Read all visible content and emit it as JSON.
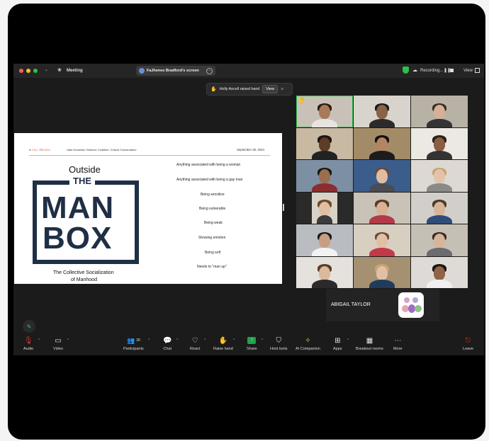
{
  "meeting": {
    "title": "Meeting",
    "share_label": "FaJhenee Bradford's screen",
    "recording_label": "Recording...",
    "view_label": "View"
  },
  "notification": {
    "text": "Holly Ancell raised hand",
    "view_button": "View",
    "close": "×"
  },
  "slide": {
    "brand_a": "A",
    "brand_call": "CALL",
    "brand_to": "TO",
    "brand_men": "MEN",
    "org": "Utah Domestic Violence Coalition: Critical Conversation",
    "date": "September 30, 2024",
    "outside": "Outside",
    "the": "THE",
    "man": "MAN",
    "box": "BOX",
    "caption_line1": "The Collective Socialization",
    "caption_line2": "of Manhood",
    "list": [
      "Anything associated with being a woman",
      "Anything associated with being a gay man",
      "Being sensitive",
      "Being vulnerable",
      "Being weak",
      "Showing emotion",
      "Being soft",
      "Needs to \"man up\""
    ]
  },
  "gallery": {
    "featured_name": "ABIGAIL TAYLOR"
  },
  "toolbar": {
    "audio": "Audio",
    "video": "Video",
    "participants_count": "20",
    "participants": "Participants",
    "chat": "Chat",
    "react": "React",
    "raise_hand": "Raise hand",
    "share": "Share",
    "host_tools": "Host tools",
    "ai_companion": "AI Companion",
    "apps": "Apps",
    "breakout_rooms": "Breakout rooms",
    "more": "More",
    "leave": "Leave"
  },
  "colors": {
    "accent_green": "#2fbf4a",
    "slide_navy": "#1f2f45",
    "brand_orange": "#e8743b",
    "share_green": "#1fa34a",
    "leave_red": "#e0332f"
  }
}
